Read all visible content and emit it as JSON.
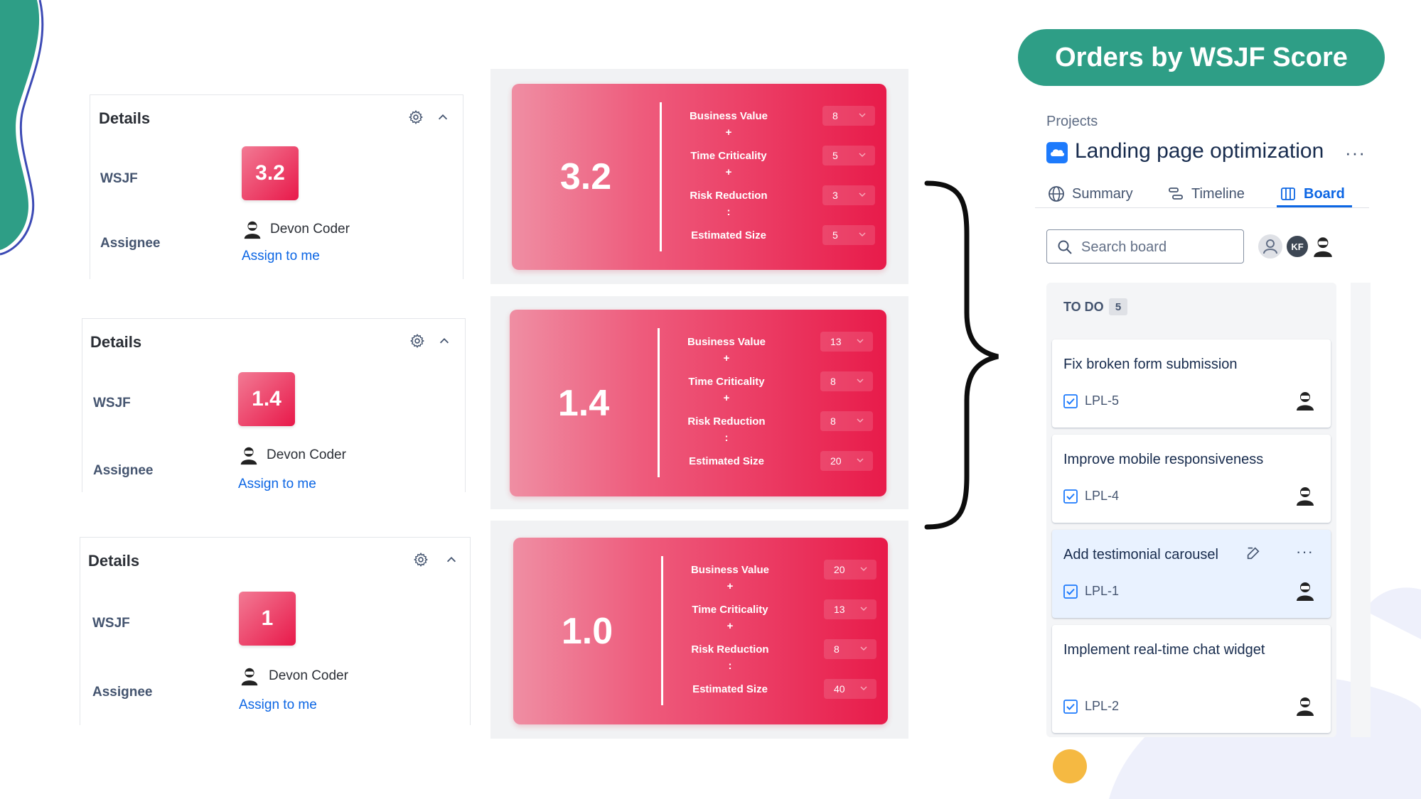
{
  "page_title": "Orders by WSJF Score",
  "colors": {
    "accent_green": "#2e9e86",
    "wsjf_red": "#e8194a",
    "link_blue": "#0c66e4",
    "deco_blue": "#3d4bb5",
    "deco_yellow": "#f5b942"
  },
  "details_panels": [
    {
      "title": "Details",
      "wsjf_label": "WSJF",
      "wsjf_value": "3.2",
      "assignee_label": "Assignee",
      "assignee_name": "Devon Coder",
      "assign_link": "Assign to me"
    },
    {
      "title": "Details",
      "wsjf_label": "WSJF",
      "wsjf_value": "1.4",
      "assignee_label": "Assignee",
      "assignee_name": "Devon Coder",
      "assign_link": "Assign to me"
    },
    {
      "title": "Details",
      "wsjf_label": "WSJF",
      "wsjf_value": "1",
      "assignee_label": "Assignee",
      "assignee_name": "Devon Coder",
      "assign_link": "Assign to me"
    }
  ],
  "calculators": [
    {
      "score": "3.2",
      "business_value": "8",
      "time_criticality": "5",
      "risk_reduction": "3",
      "estimated_size": "5"
    },
    {
      "score": "1.4",
      "business_value": "13",
      "time_criticality": "8",
      "risk_reduction": "8",
      "estimated_size": "20"
    },
    {
      "score": "1.0",
      "business_value": "20",
      "time_criticality": "13",
      "risk_reduction": "8",
      "estimated_size": "40"
    }
  ],
  "calc_labels": {
    "business_value": "Business Value",
    "time_criticality": "Time Criticality",
    "risk_reduction": "Risk Reduction",
    "estimated_size": "Estimated Size",
    "plus": "+",
    "divide": ":"
  },
  "board": {
    "breadcrumb": "Projects",
    "project_title": "Landing page optimization",
    "more": "···",
    "tabs": [
      {
        "label": "Summary",
        "icon": "globe-icon",
        "active": false
      },
      {
        "label": "Timeline",
        "icon": "timeline-icon",
        "active": false
      },
      {
        "label": "Board",
        "icon": "board-icon",
        "active": true
      }
    ],
    "search": {
      "placeholder": "Search board",
      "value": ""
    },
    "avatars": [
      {
        "name": "unassigned-avatar",
        "initials": ""
      },
      {
        "name": "kf-avatar",
        "initials": "KF"
      },
      {
        "name": "coder-avatar",
        "initials": ""
      }
    ],
    "column": {
      "title": "TO DO",
      "count": "5",
      "cards": [
        {
          "title": "Fix broken form submission",
          "key": "LPL-5",
          "highlighted": false
        },
        {
          "title": "Improve mobile responsiveness",
          "key": "LPL-4",
          "highlighted": false
        },
        {
          "title": "Add testimonial carousel",
          "key": "LPL-1",
          "highlighted": true
        },
        {
          "title": "Implement real-time chat widget",
          "key": "LPL-2",
          "highlighted": false
        }
      ]
    }
  }
}
